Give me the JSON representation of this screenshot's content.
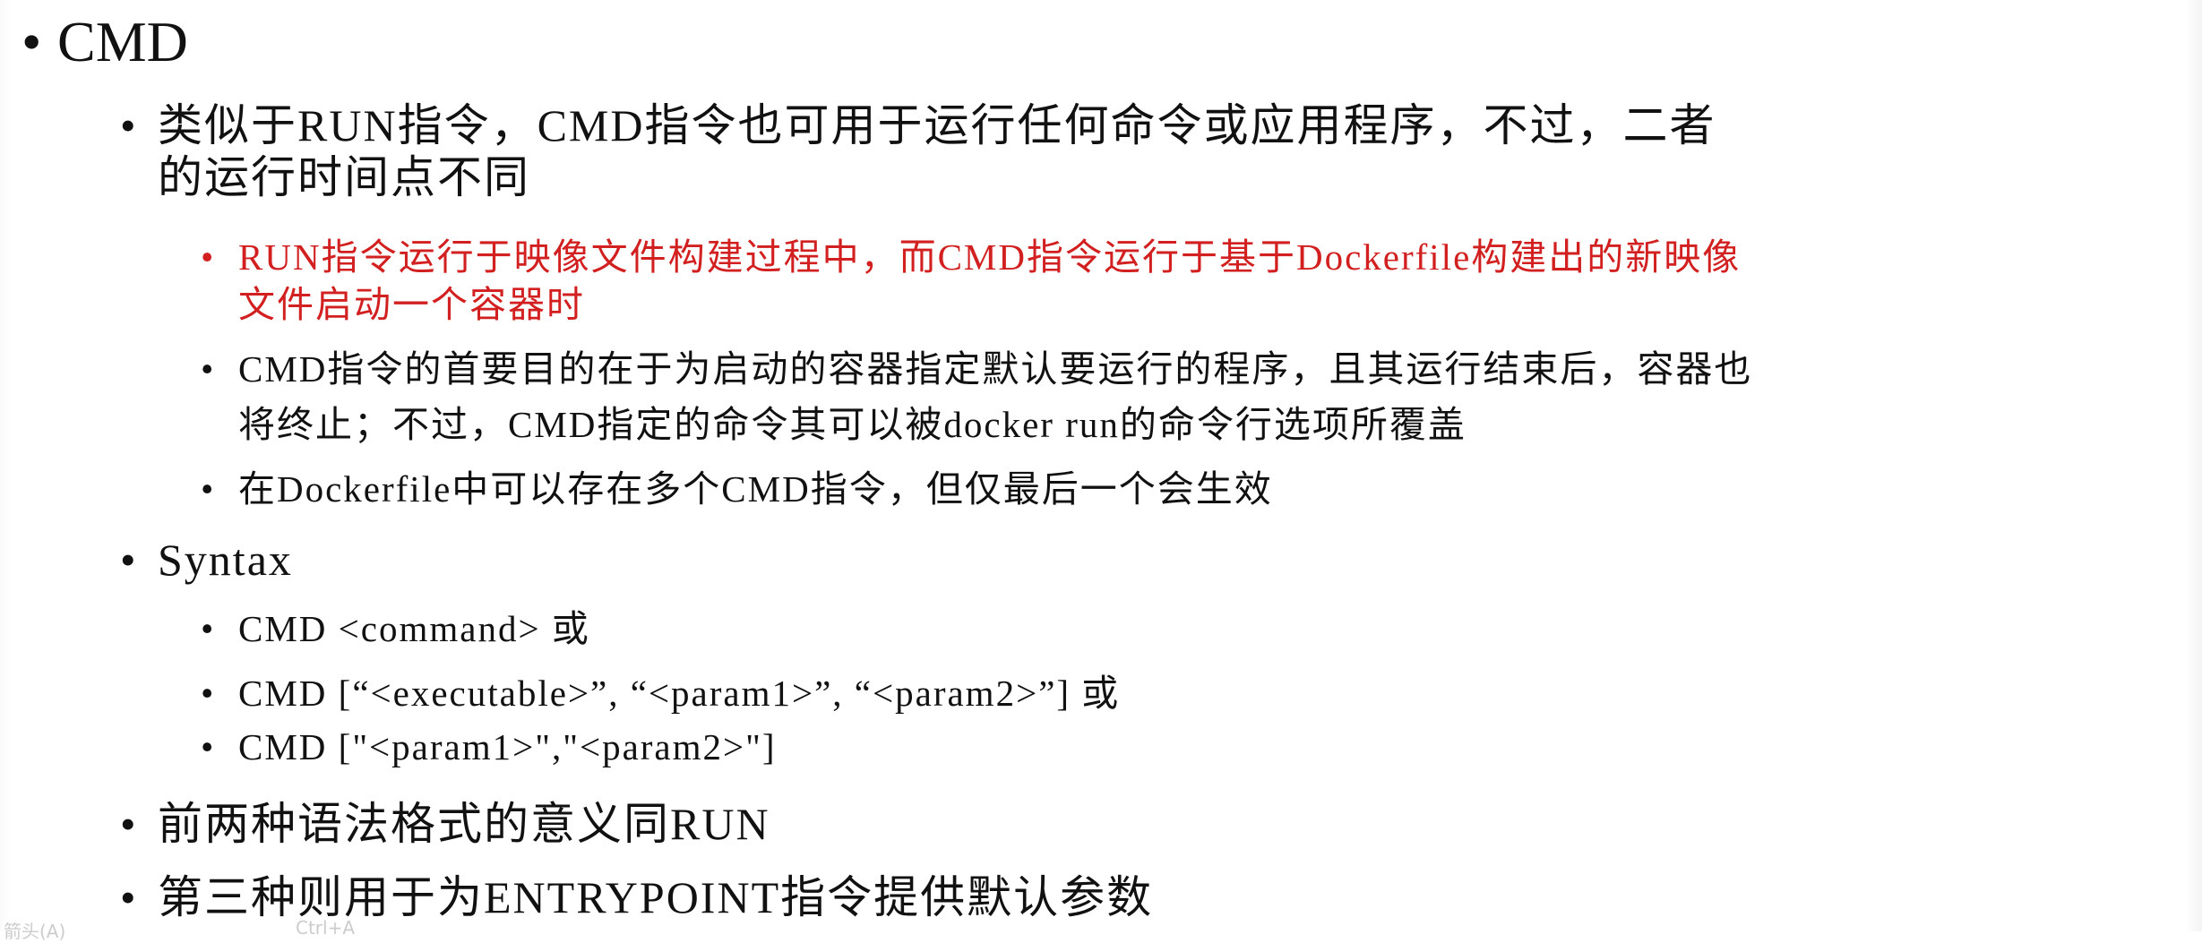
{
  "bullet_char": "•",
  "title": "CMD",
  "items": [
    {
      "line1": "类似于RUN指令，CMD指令也可用于运行任何命令或应用程序，不过，二者",
      "line2": "的运行时间点不同",
      "sub": [
        {
          "line1": "RUN指令运行于映像文件构建过程中，而CMD指令运行于基于Dockerfile构建出的新映像",
          "line2": "文件启动一个容器时",
          "color": "#d21f1f"
        },
        {
          "line1": "CMD指令的首要目的在于为启动的容器指定默认要运行的程序，且其运行结束后，容器也",
          "line2": "将终止；不过，CMD指定的命令其可以被docker run的命令行选项所覆盖"
        },
        {
          "line1": "在Dockerfile中可以存在多个CMD指令，但仅最后一个会生效"
        }
      ]
    },
    {
      "line1": "Syntax",
      "sub": [
        {
          "line1": "CMD <command> 或"
        },
        {
          "line1": "CMD [“<executable>”, “<param1>”, “<param2>”] 或"
        },
        {
          "line1": "CMD [\"<param1>\",\"<param2>\"]"
        }
      ]
    },
    {
      "line1": "前两种语法格式的意义同RUN"
    },
    {
      "line1": "第三种则用于为ENTRYPOINT指令提供默认参数"
    }
  ],
  "footer": {
    "left": "箭头(A)",
    "right": "Ctrl+A"
  }
}
